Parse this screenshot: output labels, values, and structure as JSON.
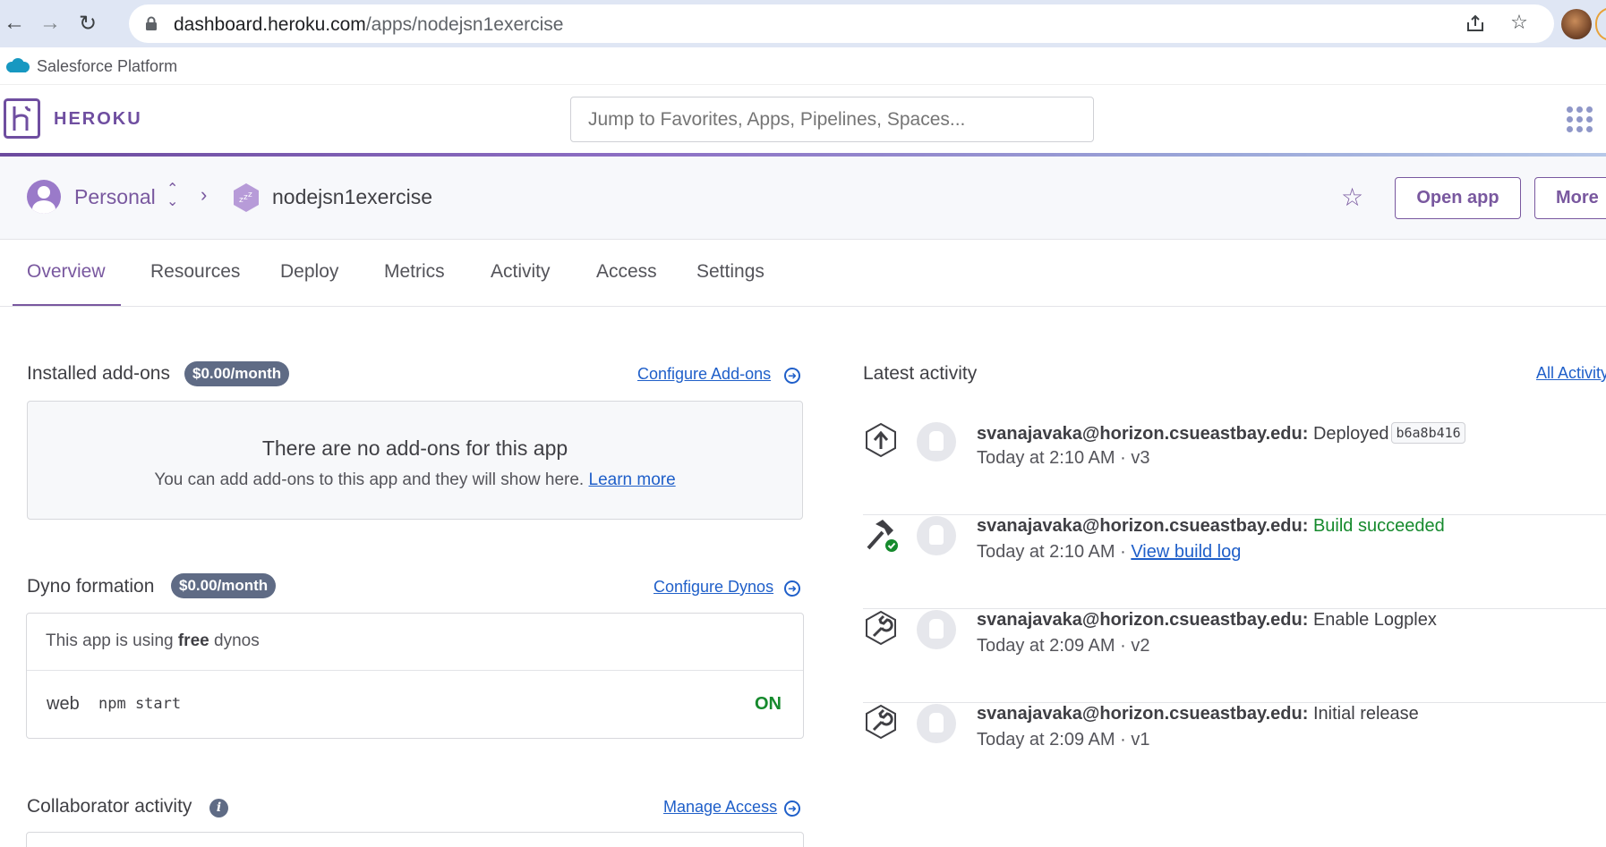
{
  "browser": {
    "url_host": "dashboard.heroku.com",
    "url_path": "/apps/nodejsn1exercise"
  },
  "salesforce": {
    "label": "Salesforce Platform"
  },
  "heroku": {
    "wordmark": "HEROKU",
    "search_placeholder": "Jump to Favorites, Apps, Pipelines, Spaces..."
  },
  "app_header": {
    "account": "Personal",
    "app_name": "nodejsn1exercise",
    "open_app_label": "Open app",
    "more_label": "More"
  },
  "tabs": [
    {
      "label": "Overview",
      "active": true
    },
    {
      "label": "Resources"
    },
    {
      "label": "Deploy"
    },
    {
      "label": "Metrics"
    },
    {
      "label": "Activity"
    },
    {
      "label": "Access"
    },
    {
      "label": "Settings"
    }
  ],
  "addons": {
    "title": "Installed add-ons",
    "price": "$0.00/month",
    "link": "Configure Add-ons",
    "empty_title": "There are no add-ons for this app",
    "empty_sub": "You can add add-ons to this app and they will show here.",
    "learn_more": "Learn more"
  },
  "dynos": {
    "title": "Dyno formation",
    "price": "$0.00/month",
    "link": "Configure Dynos",
    "note_prefix": "This app is using",
    "note_bold": "free",
    "note_suffix": "dynos",
    "process": "web",
    "command": "npm start",
    "status": "ON"
  },
  "collaborators": {
    "title": "Collaborator activity",
    "link": "Manage Access"
  },
  "activity": {
    "title": "Latest activity",
    "all_link": "All Activity",
    "items": [
      {
        "icon": "deploy-arrow-icon",
        "user": "svanajavaka@horizon.csueastbay.edu:",
        "action": "Deployed",
        "commit": "b6a8b416",
        "time": "Today at 2:10 AM",
        "meta": "v3"
      },
      {
        "icon": "build-hammer-icon",
        "user": "svanajavaka@horizon.csueastbay.edu:",
        "action": "Build succeeded",
        "time": "Today at 2:10 AM",
        "link": "View build log"
      },
      {
        "icon": "wrench-icon",
        "user": "svanajavaka@horizon.csueastbay.edu:",
        "action": "Enable Logplex",
        "time": "Today at 2:09 AM",
        "meta": "v2"
      },
      {
        "icon": "wrench-icon",
        "user": "svanajavaka@horizon.csueastbay.edu:",
        "action": "Initial release",
        "time": "Today at 2:09 AM",
        "meta": "v1"
      }
    ]
  },
  "colors": {
    "heroku_purple": "#79589f",
    "link_blue": "#1f5fc9",
    "success_green": "#168a2d",
    "badge_slate": "#5f6b85"
  }
}
